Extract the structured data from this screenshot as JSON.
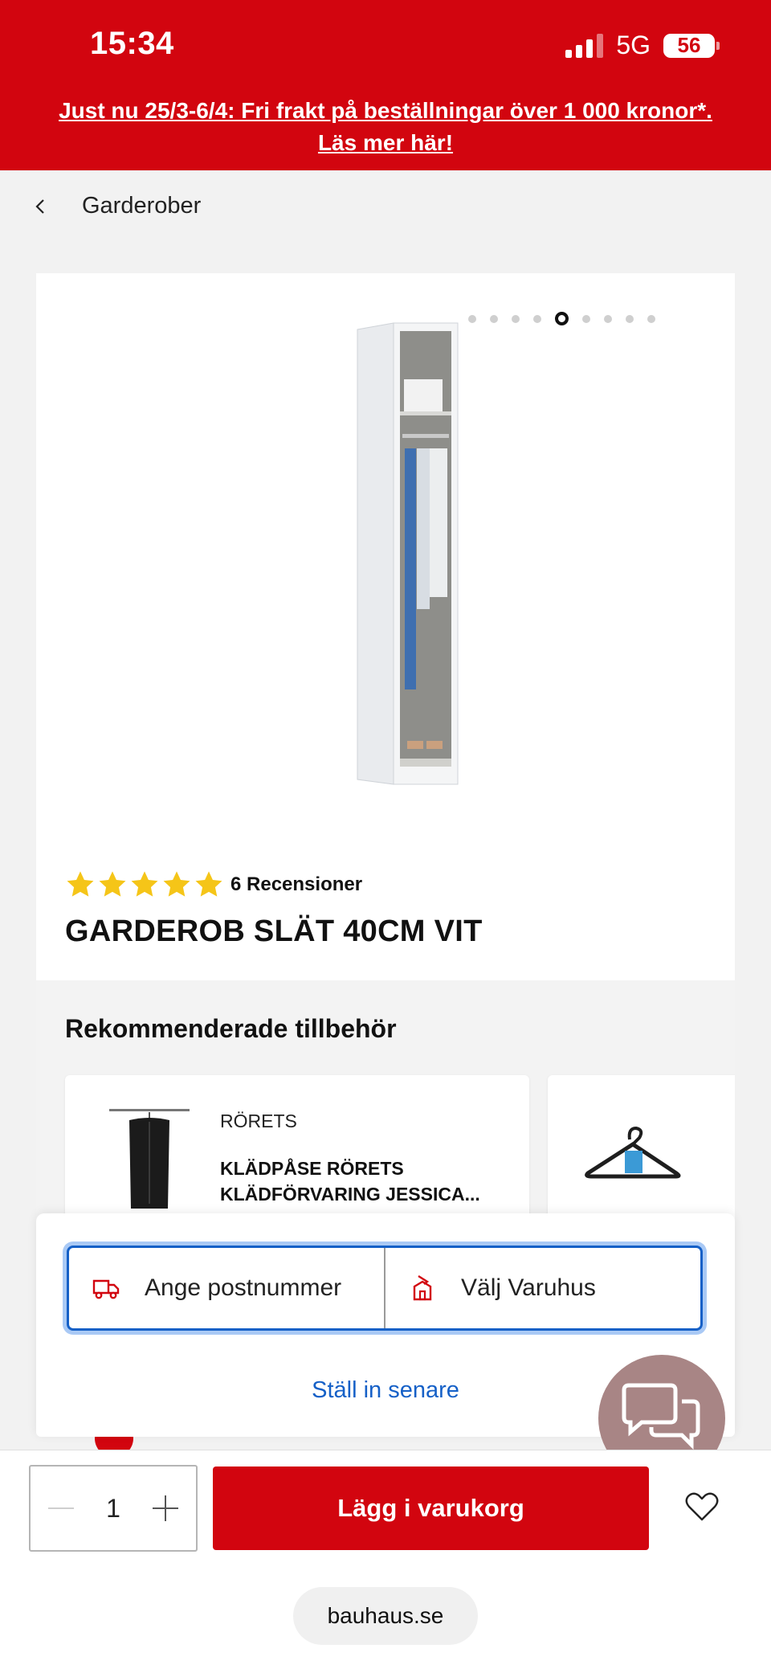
{
  "status_bar": {
    "time": "15:34",
    "network": "5G",
    "battery": "56"
  },
  "promo": {
    "line1": "Just nu 25/3-6/4: Fri frakt på beställningar över 1 000 kronor*.",
    "line2": "Läs mer här!"
  },
  "breadcrumb": {
    "label": "Garderober"
  },
  "gallery": {
    "total_images": 9,
    "active_index": 5
  },
  "product": {
    "title": "GARDEROB SLÄT 40CM VIT",
    "rating": 5,
    "review_count": "6 Recensioner"
  },
  "recommended": {
    "title": "Rekommenderade tillbehör",
    "items": [
      {
        "brand": "RÖRETS",
        "name": "KLÄDPÅSE RÖRETS KLÄDFÖRVARING JESSICA..."
      },
      {
        "brand": "",
        "name": ""
      }
    ]
  },
  "location": {
    "postcode_label": "Ange postnummer",
    "store_label": "Välj Varuhus",
    "later_label": "Ställ in senare"
  },
  "cart": {
    "quantity": "1",
    "add_label": "Lägg i varukorg"
  },
  "browser": {
    "url": "bauhaus.se"
  },
  "colors": {
    "brand_red": "#d2050f",
    "link_blue": "#1560c7",
    "star_yellow": "#f5c518"
  }
}
